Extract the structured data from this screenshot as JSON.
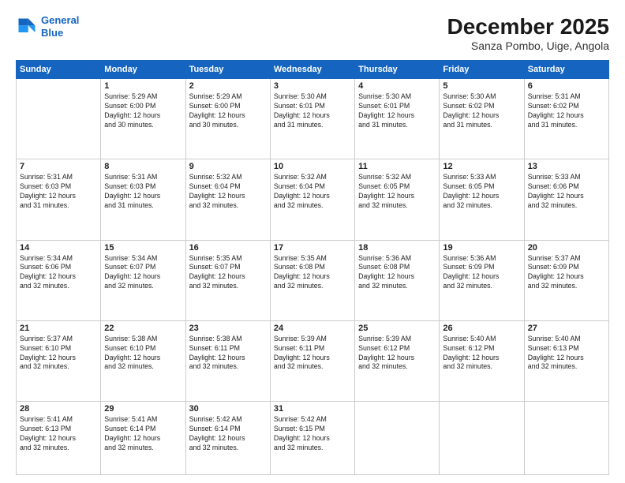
{
  "header": {
    "logo_line1": "General",
    "logo_line2": "Blue",
    "month": "December 2025",
    "location": "Sanza Pombo, Uige, Angola"
  },
  "weekdays": [
    "Sunday",
    "Monday",
    "Tuesday",
    "Wednesday",
    "Thursday",
    "Friday",
    "Saturday"
  ],
  "weeks": [
    [
      {
        "day": "",
        "info": ""
      },
      {
        "day": "1",
        "info": "Sunrise: 5:29 AM\nSunset: 6:00 PM\nDaylight: 12 hours\nand 30 minutes."
      },
      {
        "day": "2",
        "info": "Sunrise: 5:29 AM\nSunset: 6:00 PM\nDaylight: 12 hours\nand 30 minutes."
      },
      {
        "day": "3",
        "info": "Sunrise: 5:30 AM\nSunset: 6:01 PM\nDaylight: 12 hours\nand 31 minutes."
      },
      {
        "day": "4",
        "info": "Sunrise: 5:30 AM\nSunset: 6:01 PM\nDaylight: 12 hours\nand 31 minutes."
      },
      {
        "day": "5",
        "info": "Sunrise: 5:30 AM\nSunset: 6:02 PM\nDaylight: 12 hours\nand 31 minutes."
      },
      {
        "day": "6",
        "info": "Sunrise: 5:31 AM\nSunset: 6:02 PM\nDaylight: 12 hours\nand 31 minutes."
      }
    ],
    [
      {
        "day": "7",
        "info": "Sunrise: 5:31 AM\nSunset: 6:03 PM\nDaylight: 12 hours\nand 31 minutes."
      },
      {
        "day": "8",
        "info": "Sunrise: 5:31 AM\nSunset: 6:03 PM\nDaylight: 12 hours\nand 31 minutes."
      },
      {
        "day": "9",
        "info": "Sunrise: 5:32 AM\nSunset: 6:04 PM\nDaylight: 12 hours\nand 32 minutes."
      },
      {
        "day": "10",
        "info": "Sunrise: 5:32 AM\nSunset: 6:04 PM\nDaylight: 12 hours\nand 32 minutes."
      },
      {
        "day": "11",
        "info": "Sunrise: 5:32 AM\nSunset: 6:05 PM\nDaylight: 12 hours\nand 32 minutes."
      },
      {
        "day": "12",
        "info": "Sunrise: 5:33 AM\nSunset: 6:05 PM\nDaylight: 12 hours\nand 32 minutes."
      },
      {
        "day": "13",
        "info": "Sunrise: 5:33 AM\nSunset: 6:06 PM\nDaylight: 12 hours\nand 32 minutes."
      }
    ],
    [
      {
        "day": "14",
        "info": "Sunrise: 5:34 AM\nSunset: 6:06 PM\nDaylight: 12 hours\nand 32 minutes."
      },
      {
        "day": "15",
        "info": "Sunrise: 5:34 AM\nSunset: 6:07 PM\nDaylight: 12 hours\nand 32 minutes."
      },
      {
        "day": "16",
        "info": "Sunrise: 5:35 AM\nSunset: 6:07 PM\nDaylight: 12 hours\nand 32 minutes."
      },
      {
        "day": "17",
        "info": "Sunrise: 5:35 AM\nSunset: 6:08 PM\nDaylight: 12 hours\nand 32 minutes."
      },
      {
        "day": "18",
        "info": "Sunrise: 5:36 AM\nSunset: 6:08 PM\nDaylight: 12 hours\nand 32 minutes."
      },
      {
        "day": "19",
        "info": "Sunrise: 5:36 AM\nSunset: 6:09 PM\nDaylight: 12 hours\nand 32 minutes."
      },
      {
        "day": "20",
        "info": "Sunrise: 5:37 AM\nSunset: 6:09 PM\nDaylight: 12 hours\nand 32 minutes."
      }
    ],
    [
      {
        "day": "21",
        "info": "Sunrise: 5:37 AM\nSunset: 6:10 PM\nDaylight: 12 hours\nand 32 minutes."
      },
      {
        "day": "22",
        "info": "Sunrise: 5:38 AM\nSunset: 6:10 PM\nDaylight: 12 hours\nand 32 minutes."
      },
      {
        "day": "23",
        "info": "Sunrise: 5:38 AM\nSunset: 6:11 PM\nDaylight: 12 hours\nand 32 minutes."
      },
      {
        "day": "24",
        "info": "Sunrise: 5:39 AM\nSunset: 6:11 PM\nDaylight: 12 hours\nand 32 minutes."
      },
      {
        "day": "25",
        "info": "Sunrise: 5:39 AM\nSunset: 6:12 PM\nDaylight: 12 hours\nand 32 minutes."
      },
      {
        "day": "26",
        "info": "Sunrise: 5:40 AM\nSunset: 6:12 PM\nDaylight: 12 hours\nand 32 minutes."
      },
      {
        "day": "27",
        "info": "Sunrise: 5:40 AM\nSunset: 6:13 PM\nDaylight: 12 hours\nand 32 minutes."
      }
    ],
    [
      {
        "day": "28",
        "info": "Sunrise: 5:41 AM\nSunset: 6:13 PM\nDaylight: 12 hours\nand 32 minutes."
      },
      {
        "day": "29",
        "info": "Sunrise: 5:41 AM\nSunset: 6:14 PM\nDaylight: 12 hours\nand 32 minutes."
      },
      {
        "day": "30",
        "info": "Sunrise: 5:42 AM\nSunset: 6:14 PM\nDaylight: 12 hours\nand 32 minutes."
      },
      {
        "day": "31",
        "info": "Sunrise: 5:42 AM\nSunset: 6:15 PM\nDaylight: 12 hours\nand 32 minutes."
      },
      {
        "day": "",
        "info": ""
      },
      {
        "day": "",
        "info": ""
      },
      {
        "day": "",
        "info": ""
      }
    ]
  ]
}
